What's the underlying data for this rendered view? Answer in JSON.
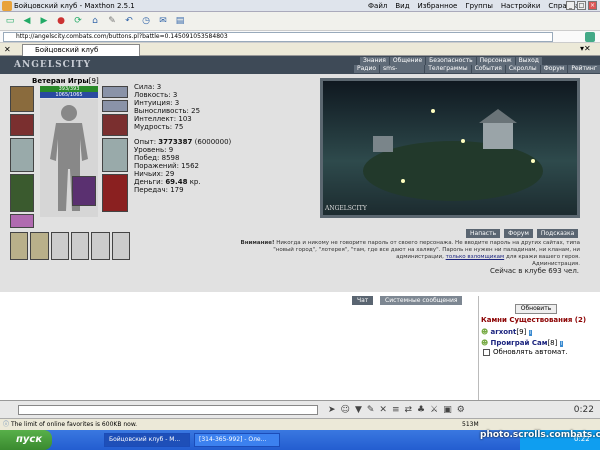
{
  "window": {
    "title": "Бойцовский клуб - Maxthon 2.5.1",
    "menu": [
      "Файл",
      "Вид",
      "Избранное",
      "Группы",
      "Настройки",
      "Справка"
    ]
  },
  "address": {
    "url": "http://angelscity.combats.com/buttons.pl?battle=0.145091053584803"
  },
  "tab": {
    "label": "Бойцовский клуб"
  },
  "game": {
    "logo": "ANGELSCITY",
    "nav_top": [
      "Знания",
      "Общение",
      "Безопасность",
      "Персонаж",
      "Выход"
    ],
    "nav_bottom": [
      "Радио",
      "sms-история",
      "Телеграммы",
      "События",
      "Скроллы",
      "Форум",
      "Рейтинг"
    ],
    "character": {
      "name": "Ветеран Игры",
      "level": "[9]",
      "hp": "393/393",
      "mana": "1065/1065"
    },
    "stats": [
      {
        "label": "Сила:",
        "value": "3"
      },
      {
        "label": "Ловкость:",
        "value": "3"
      },
      {
        "label": "Интуиция:",
        "value": "3"
      },
      {
        "label": "Выносливость:",
        "value": "25"
      },
      {
        "label": "Интеллект:",
        "value": "103"
      },
      {
        "label": "Мудрость:",
        "value": "75"
      }
    ],
    "progress": [
      {
        "label": "Опыт:",
        "value": "3773387",
        "extra": "(6000000)"
      },
      {
        "label": "Уровень:",
        "value": "9"
      },
      {
        "label": "Побед:",
        "value": "8598"
      },
      {
        "label": "Поражений:",
        "value": "1562"
      },
      {
        "label": "Ничьих:",
        "value": "29"
      },
      {
        "label": "Деньги:",
        "value": "69.48",
        "extra": "кр."
      },
      {
        "label": "Передач:",
        "value": "179"
      }
    ],
    "scene_logo": "ANGELSCITY",
    "buttons": [
      "Напасть",
      "Форум",
      "Подсказка"
    ],
    "warning_bold": "Внимание!",
    "warning": "Никогда и никому не говорите пароль от своего персонажа. Не вводите пароль на других сайтах, типа \"новый город\", \"лотерея\", \"там, где все дают на халяву\". Пароль не нужен ни паладинам, ни кланам, ни администрации,",
    "warning_link": "только взломщикам",
    "warning_end": "для кражи вашего героя.",
    "signature": "Администрация.",
    "online": "Сейчас в клубе 693 чел."
  },
  "chat": {
    "tabs": [
      "Чат",
      "Системные сообщения"
    ]
  },
  "right_panel": {
    "refresh": "Обновить",
    "room": "Камни Существования (2)",
    "users": [
      {
        "name": "arxont",
        "level": "[9]"
      },
      {
        "name": "Проиграй Сам",
        "level": "[8]"
      }
    ],
    "auto_refresh": "Обновлять автомат."
  },
  "clock": "0:22",
  "status_text": "The limit of online favorites is 600KB now.",
  "status_right": "513M",
  "taskbar": {
    "start": "пуск",
    "tasks": [
      "Бойцовский клуб - M...",
      "[314-365-992] - Оле..."
    ],
    "time": "0:22"
  },
  "watermark": "photo.scrolls.combats.com",
  "colors": {
    "nav_bg": "#3e4a57",
    "panel_bg": "#e1e1e1",
    "room": "#8b0000",
    "user": "#1a237e",
    "taskbar": "#235dd0"
  }
}
